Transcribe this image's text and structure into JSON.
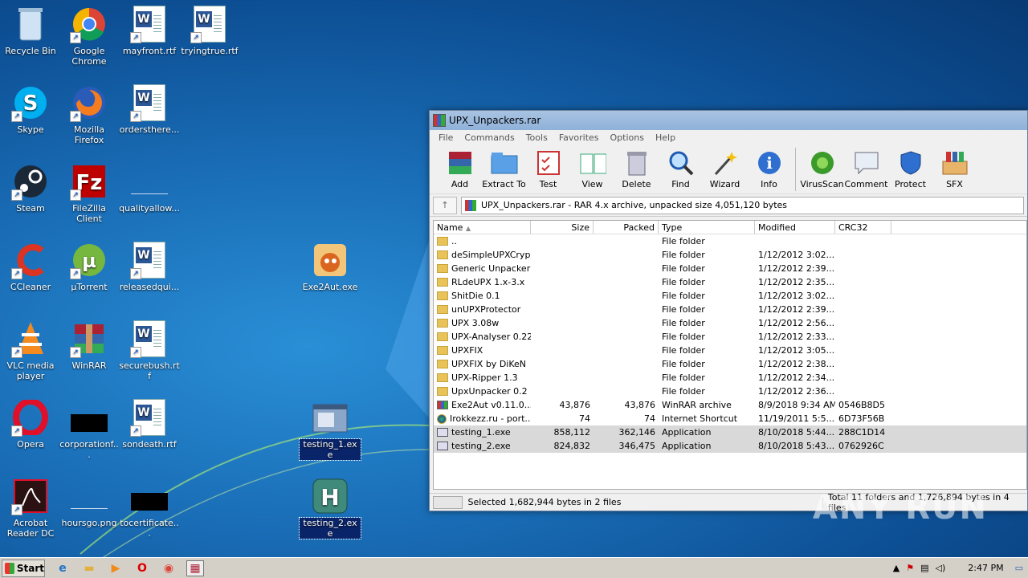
{
  "desktop_icons": [
    {
      "label": "Recycle Bin"
    },
    {
      "label": "Google Chrome"
    },
    {
      "label": "mayfront.rtf"
    },
    {
      "label": "tryingtrue.rtf"
    },
    {
      "label": "Skype"
    },
    {
      "label": "Mozilla Firefox"
    },
    {
      "label": "ordersthere..."
    },
    {
      "label": "Steam"
    },
    {
      "label": "FileZilla Client"
    },
    {
      "label": "qualityallow..."
    },
    {
      "label": "CCleaner"
    },
    {
      "label": "µTorrent"
    },
    {
      "label": "releasedqui..."
    },
    {
      "label": "Exe2Aut.exe"
    },
    {
      "label": "VLC media player"
    },
    {
      "label": "WinRAR"
    },
    {
      "label": "securebush.rtf"
    },
    {
      "label": "Opera"
    },
    {
      "label": "corporationf..."
    },
    {
      "label": "sondeath.rtf"
    },
    {
      "label": "testing_1.exe"
    },
    {
      "label": "Acrobat Reader DC"
    },
    {
      "label": "hoursgo.png"
    },
    {
      "label": "tocertificate..."
    },
    {
      "label": "testing_2.exe"
    }
  ],
  "window": {
    "title": "UPX_Unpackers.rar",
    "menu": [
      "File",
      "Commands",
      "Tools",
      "Favorites",
      "Options",
      "Help"
    ],
    "toolbar": [
      "Add",
      "Extract To",
      "Test",
      "View",
      "Delete",
      "Find",
      "Wizard",
      "Info",
      "VirusScan",
      "Comment",
      "Protect",
      "SFX"
    ],
    "address": "UPX_Unpackers.rar - RAR 4.x archive, unpacked size 4,051,120 bytes",
    "columns": [
      "Name",
      "Size",
      "Packed",
      "Type",
      "Modified",
      "CRC32"
    ],
    "rows": [
      {
        "name": "..",
        "size": "",
        "packed": "",
        "type": "File folder",
        "modified": "",
        "crc": ""
      },
      {
        "name": "deSimpleUPXCryp...",
        "size": "",
        "packed": "",
        "type": "File folder",
        "modified": "1/12/2012 3:02...",
        "crc": ""
      },
      {
        "name": "Generic Unpacker",
        "size": "",
        "packed": "",
        "type": "File folder",
        "modified": "1/12/2012 2:39...",
        "crc": ""
      },
      {
        "name": "RLdeUPX 1.x-3.x",
        "size": "",
        "packed": "",
        "type": "File folder",
        "modified": "1/12/2012 2:35...",
        "crc": ""
      },
      {
        "name": "ShitDie 0.1",
        "size": "",
        "packed": "",
        "type": "File folder",
        "modified": "1/12/2012 3:02...",
        "crc": ""
      },
      {
        "name": "unUPXProtector",
        "size": "",
        "packed": "",
        "type": "File folder",
        "modified": "1/12/2012 2:39...",
        "crc": ""
      },
      {
        "name": "UPX 3.08w",
        "size": "",
        "packed": "",
        "type": "File folder",
        "modified": "1/12/2012 2:56...",
        "crc": ""
      },
      {
        "name": "UPX-Analyser 0.22",
        "size": "",
        "packed": "",
        "type": "File folder",
        "modified": "1/12/2012 2:33...",
        "crc": ""
      },
      {
        "name": "UPXFIX",
        "size": "",
        "packed": "",
        "type": "File folder",
        "modified": "1/12/2012 3:05...",
        "crc": ""
      },
      {
        "name": "UPXFIX by DiKeN",
        "size": "",
        "packed": "",
        "type": "File folder",
        "modified": "1/12/2012 2:38...",
        "crc": ""
      },
      {
        "name": "UPX-Ripper 1.3",
        "size": "",
        "packed": "",
        "type": "File folder",
        "modified": "1/12/2012 2:34...",
        "crc": ""
      },
      {
        "name": "UpxUnpacker 0.2",
        "size": "",
        "packed": "",
        "type": "File folder",
        "modified": "1/12/2012 2:36...",
        "crc": ""
      },
      {
        "name": "Exe2Aut v0.11.0...",
        "size": "43,876",
        "packed": "43,876",
        "type": "WinRAR archive",
        "modified": "8/9/2018 9:34 AM",
        "crc": "0546B8D5"
      },
      {
        "name": "Irokkezz.ru - port...",
        "size": "74",
        "packed": "74",
        "type": "Internet Shortcut",
        "modified": "11/19/2011 5:5...",
        "crc": "6D73F56B"
      },
      {
        "name": "testing_1.exe",
        "size": "858,112",
        "packed": "362,146",
        "type": "Application",
        "modified": "8/10/2018 5:44...",
        "crc": "288C1D14"
      },
      {
        "name": "testing_2.exe",
        "size": "824,832",
        "packed": "346,475",
        "type": "Application",
        "modified": "8/10/2018 5:43...",
        "crc": "0762926C"
      }
    ],
    "status_left": "Selected 1,682,944 bytes in 2 files",
    "status_right": "Total 11 folders and 1,726,894 bytes in 4 files"
  },
  "taskbar": {
    "start": "Start",
    "clock": "2:47 PM"
  },
  "watermark": "ANY RUN"
}
